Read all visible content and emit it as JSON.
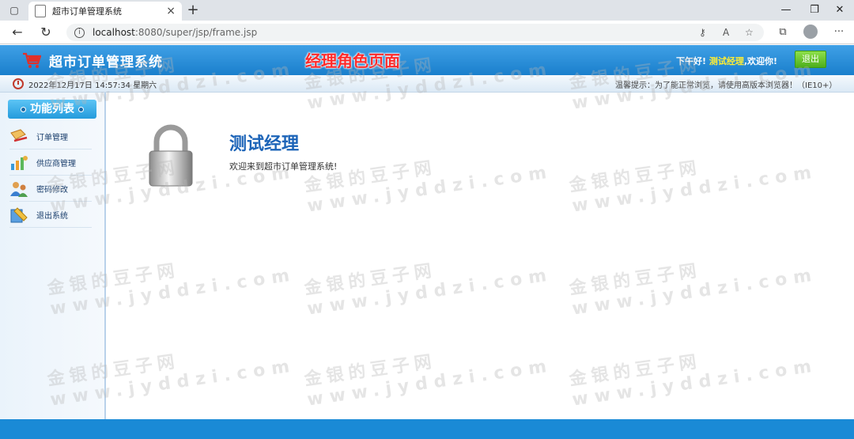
{
  "browser": {
    "tab_title": "超市订单管理系统",
    "url_host": "localhost",
    "url_path": ":8080/super/jsp/frame.jsp"
  },
  "header": {
    "app_title": "超市订单管理系统",
    "role_title": "经理角色页面",
    "greeting_prefix": "下午好!",
    "user_name": "测试经理",
    "greeting_suffix": ",欢迎你!",
    "logout_label": "退出"
  },
  "infostrip": {
    "datetime": "2022年12月17日 14:57:34 星期六",
    "tip": "温馨提示：为了能正常浏览，请使用高版本浏览器！（IE10+）"
  },
  "sidebar": {
    "title": "功能列表",
    "items": [
      {
        "label": "订单管理",
        "icon": "order-icon"
      },
      {
        "label": "供应商管理",
        "icon": "supplier-icon"
      },
      {
        "label": "密码修改",
        "icon": "password-icon"
      },
      {
        "label": "退出系统",
        "icon": "exit-icon"
      }
    ]
  },
  "main": {
    "welcome_title": "测试经理",
    "welcome_text": "欢迎来到超市订单管理系统!"
  },
  "watermark": {
    "cn": "金银的豆子网",
    "en": "www.jyddzi.com"
  },
  "colors": {
    "header": "#1a7fcc",
    "accent_red": "#ff2a2a",
    "footer": "#1a8ad6"
  }
}
